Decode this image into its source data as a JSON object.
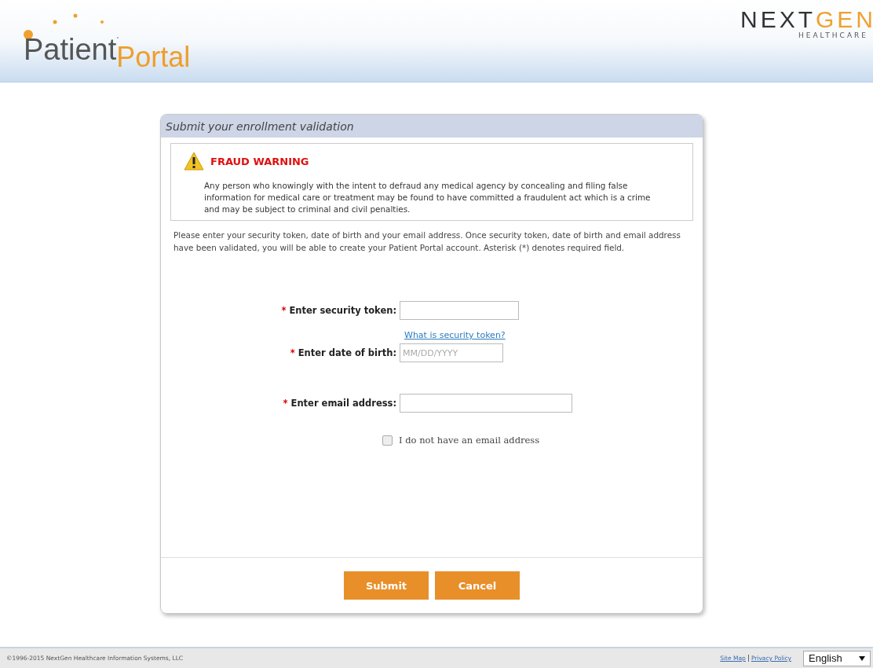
{
  "header": {
    "logo": {
      "first": "Patient",
      "second": "Portal"
    },
    "brand": {
      "first": "NEXT",
      "second": "GEN",
      "sub": "HEALTHCARE"
    }
  },
  "panel": {
    "title": "Submit your enrollment validation",
    "warning": {
      "title": "FRAUD WARNING",
      "text": "Any person who knowingly with the intent to defraud any medical agency by concealing and filing false information for medical care or treatment may be found to have committed a fraudulent act which is a crime and may be subject to criminal and civil penalties."
    },
    "intro": "Please enter your security token, date of birth and your email address. Once security token, date of birth and email address have been validated, you will be able to create your Patient Portal account. Asterisk (*) denotes required field.",
    "fields": [
      {
        "marker": "*",
        "label": "Enter security token:",
        "kind": "token",
        "link": "What is security token?"
      },
      {
        "marker": "*",
        "label": "Enter date of birth:",
        "kind": "date",
        "placeholder": "MM/DD/YYYY"
      },
      {
        "marker": "*",
        "label": "Enter email address:",
        "kind": "email"
      }
    ],
    "checkbox": {
      "label": "I do not have an email address",
      "checked": false
    },
    "buttons": [
      "Submit",
      "Cancel"
    ]
  },
  "footer": {
    "copyright": "©1996-2015 NextGen Healthcare Information Systems, LLC",
    "links": [
      "Site Map",
      "Privacy Policy"
    ],
    "language": "English"
  }
}
